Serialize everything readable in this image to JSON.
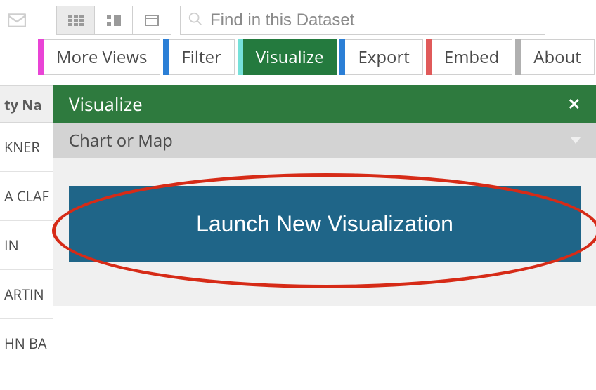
{
  "search": {
    "placeholder": "Find in this Dataset",
    "value": ""
  },
  "tabs": [
    {
      "label": "More Views",
      "stripe": "#e944d6",
      "active": false
    },
    {
      "label": "Filter",
      "stripe": "#2b7fd6",
      "active": false
    },
    {
      "label": "Visualize",
      "stripe": "#76e1da",
      "active": true
    },
    {
      "label": "Export",
      "stripe": "#2b7fd6",
      "active": false
    },
    {
      "label": "Embed",
      "stripe": "#e05a5a",
      "active": false
    },
    {
      "label": "About",
      "stripe": "#b0b0b0",
      "active": false
    }
  ],
  "table": {
    "column_header": "ty Na",
    "rows": [
      "KNER",
      "A CLAF",
      "IN",
      "ARTIN",
      "HN BA"
    ]
  },
  "panel": {
    "title": "Visualize",
    "sub": "Chart or Map",
    "launch_label": "Launch New Visualization"
  }
}
